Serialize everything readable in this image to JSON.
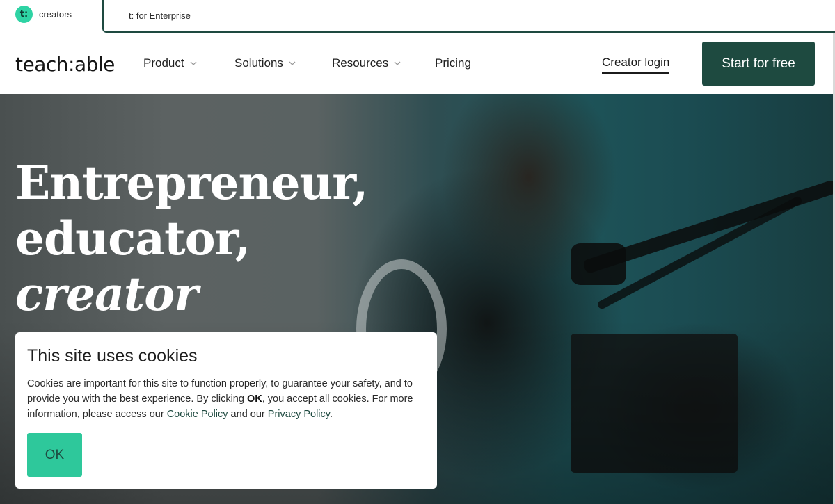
{
  "audience_tabs": {
    "creators": {
      "badge": "t:",
      "label": "creators"
    },
    "enterprise": {
      "label": "t: for Enterprise"
    }
  },
  "nav": {
    "brand": "teach:able",
    "items": [
      {
        "label": "Product",
        "has_dropdown": true
      },
      {
        "label": "Solutions",
        "has_dropdown": true
      },
      {
        "label": "Resources",
        "has_dropdown": true
      },
      {
        "label": "Pricing",
        "has_dropdown": false
      }
    ],
    "creator_login": "Creator login",
    "cta": "Start for free"
  },
  "hero": {
    "title_lines": [
      "Entrepreneur,",
      "educator,",
      "creator"
    ]
  },
  "cookie_banner": {
    "title": "This site uses cookies",
    "text_before_ok": "Cookies are important for this site to function properly, to guarantee your safety, and to provide you with the best experience. By clicking ",
    "ok_inline": "OK",
    "text_after_ok": ", you accept all cookies. For more information, please access our ",
    "cookie_policy_link": "Cookie Policy",
    "text_between_links": " and our ",
    "privacy_policy_link": "Privacy Policy",
    "text_end": ".",
    "ok_button": "OK"
  },
  "colors": {
    "brand_dark_green": "#1e4a40",
    "accent_mint": "#2ec89b",
    "badge_mint": "#2ed3a4"
  },
  "icons": {
    "dropdown": "chevron-down-icon"
  }
}
